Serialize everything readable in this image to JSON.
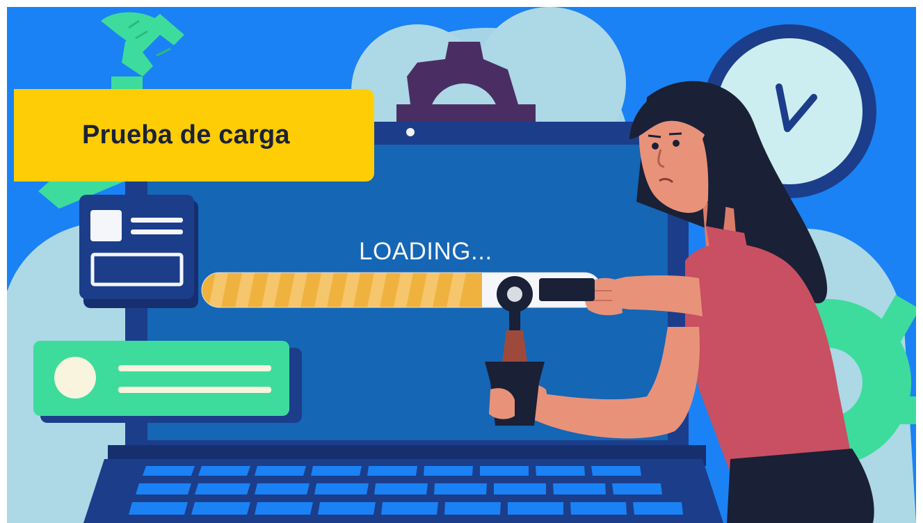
{
  "banner": {
    "title": "Prueba de carga"
  },
  "screen": {
    "status_text": "LOADING..."
  },
  "progress": {
    "value_percent": 70
  },
  "colors": {
    "background": "#1a82f4",
    "banner": "#ffcd05",
    "laptop_screen": "#1566b5",
    "laptop_frame": "#1c3d8a",
    "progress_fill": "#f0b23f",
    "accent_green": "#3ddc9c",
    "shirt": "#c94f62",
    "skin": "#e8927a",
    "hair": "#1a2035"
  },
  "icons": [
    "wrench-icon",
    "gear-icon",
    "clock-icon",
    "card-icon",
    "notification-icon"
  ]
}
